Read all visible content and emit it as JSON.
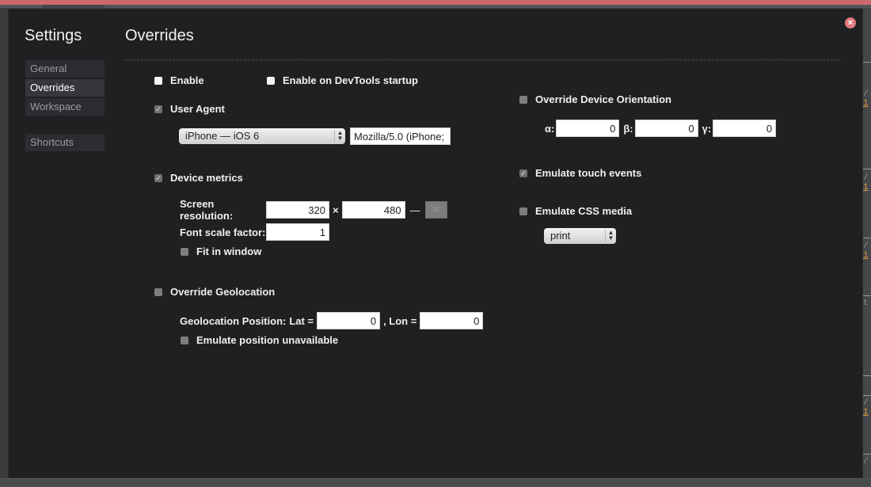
{
  "dialog": {
    "settings_title": "Settings",
    "close_icon": "close-icon",
    "page_title": "Overrides"
  },
  "sidebar": {
    "items": [
      {
        "label": "General",
        "active": false
      },
      {
        "label": "Overrides",
        "active": true
      },
      {
        "label": "Workspace",
        "active": false
      },
      {
        "label": "Shortcuts",
        "active": false
      }
    ]
  },
  "overrides": {
    "enable": {
      "label": "Enable",
      "checked": false
    },
    "enable_startup": {
      "label": "Enable on DevTools startup",
      "checked": false
    },
    "user_agent": {
      "label": "User Agent",
      "checked": true,
      "select_value": "iPhone — iOS 6",
      "ua_value": "Mozilla/5.0 (iPhone;"
    },
    "device_metrics": {
      "label": "Device metrics",
      "checked": true,
      "screen_resolution_label": "Screen resolution:",
      "width": "320",
      "times": "×",
      "height": "480",
      "dash": "—",
      "swap_icon": "swap-dimensions-icon",
      "font_scale_label": "Font scale factor:",
      "font_scale": "1",
      "fit_in_window": {
        "label": "Fit in window",
        "checked": false
      }
    },
    "geolocation": {
      "label": "Override Geolocation",
      "checked": false,
      "position_label": "Geolocation Position:",
      "lat_label": "Lat =",
      "lat": "0",
      "lon_label": ", Lon =",
      "lon": "0",
      "unavailable": {
        "label": "Emulate position unavailable",
        "checked": false
      }
    },
    "device_orientation": {
      "label": "Override Device Orientation",
      "checked": false,
      "alpha_label": "α:",
      "alpha": "0",
      "beta_label": "β:",
      "beta": "0",
      "gamma_label": "γ:",
      "gamma": "0"
    },
    "touch_events": {
      "label": "Emulate touch events",
      "checked": true
    },
    "css_media": {
      "label": "Emulate CSS media",
      "checked": false,
      "select_value": "print"
    }
  },
  "colors": {
    "dialog_bg": "#1f2022",
    "close_button": "#e07b7d",
    "top_bar": "#c96a6c",
    "accent_number": "#d99c3b"
  }
}
